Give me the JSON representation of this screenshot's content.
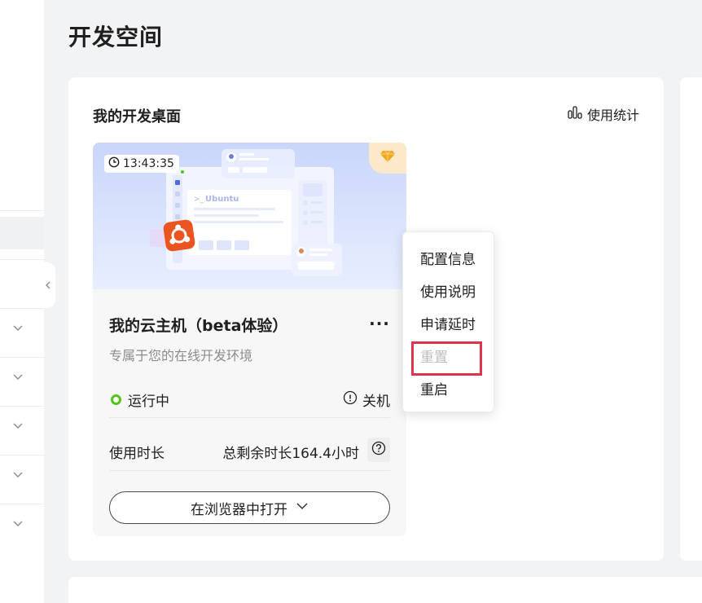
{
  "page": {
    "title": "开发空间"
  },
  "sidebar": {
    "active_item_index": 0,
    "chevron_count": 5
  },
  "dev_desktop": {
    "section_title": "我的开发桌面",
    "stats_label": "使用统计"
  },
  "host_card": {
    "timer": "13:43:35",
    "hero_logo_text": "Ubuntu",
    "name": "我的云主机（beta体验）",
    "more_label": "···",
    "description": "专属于您的在线开发环境",
    "status": "运行中",
    "shutdown_label": "关机",
    "usage_label": "使用时长",
    "usage_value": "总剩余时长164.4小时",
    "open_button_label": "在浏览器中打开"
  },
  "menu": {
    "items": [
      {
        "label": "配置信息",
        "disabled": false
      },
      {
        "label": "使用说明",
        "disabled": false
      },
      {
        "label": "申请延时",
        "disabled": false
      },
      {
        "label": "重置",
        "disabled": true
      },
      {
        "label": "重启",
        "disabled": false
      }
    ]
  },
  "colors": {
    "status_green": "#52c41a",
    "highlight_red": "#e0334d",
    "hero_blue": "#c9d6fb",
    "ubuntu_orange": "#e95420",
    "pro_badge": "#f5a623"
  }
}
